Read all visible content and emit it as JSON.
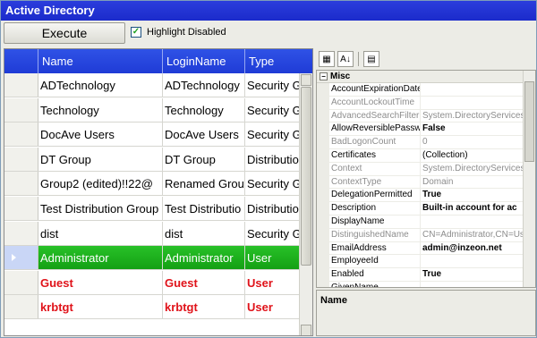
{
  "window": {
    "title": "Active Directory"
  },
  "toolbar": {
    "execute_label": "Execute",
    "highlight_label": "Highlight Disabled",
    "highlight_checked": true
  },
  "grid": {
    "columns": [
      "Name",
      "LoginName",
      "Type"
    ],
    "rows": [
      {
        "name": "ADTechnology",
        "login": "ADTechnology",
        "type": "Security G",
        "state": "normal"
      },
      {
        "name": "Technology",
        "login": "Technology",
        "type": "Security G",
        "state": "normal"
      },
      {
        "name": "DocAve Users",
        "login": "DocAve Users",
        "type": "Security G",
        "state": "normal"
      },
      {
        "name": "DT Group",
        "login": "DT Group",
        "type": "Distributio",
        "state": "normal"
      },
      {
        "name": "Group2 (edited)!!22@",
        "login": "Renamed Grou",
        "type": "Security G",
        "state": "normal"
      },
      {
        "name": "Test Distribution Group",
        "login": "Test Distributio",
        "type": "Distributio",
        "state": "normal"
      },
      {
        "name": "dist",
        "login": "dist",
        "type": "Security G",
        "state": "normal"
      },
      {
        "name": "Administrator",
        "login": "Administrator",
        "type": "User",
        "state": "selected"
      },
      {
        "name": "Guest",
        "login": "Guest",
        "type": "User",
        "state": "disabled"
      },
      {
        "name": "krbtgt",
        "login": "krbtgt",
        "type": "User",
        "state": "disabled"
      }
    ]
  },
  "properties": {
    "category": "Misc",
    "rows": [
      {
        "name": "AccountExpirationDate",
        "value": "",
        "readonly": false,
        "bold": false
      },
      {
        "name": "AccountLockoutTime",
        "value": "",
        "readonly": true,
        "bold": false
      },
      {
        "name": "AdvancedSearchFilter",
        "value": "System.DirectoryServices.",
        "readonly": true,
        "bold": false
      },
      {
        "name": "AllowReversiblePassw",
        "value": "False",
        "readonly": false,
        "bold": true
      },
      {
        "name": "BadLogonCount",
        "value": "0",
        "readonly": true,
        "bold": false
      },
      {
        "name": "Certificates",
        "value": "(Collection)",
        "readonly": false,
        "bold": false
      },
      {
        "name": "Context",
        "value": "System.DirectoryServices.",
        "readonly": true,
        "bold": false
      },
      {
        "name": "ContextType",
        "value": "Domain",
        "readonly": true,
        "bold": false
      },
      {
        "name": "DelegationPermitted",
        "value": "True",
        "readonly": false,
        "bold": true
      },
      {
        "name": "Description",
        "value": "Built-in account for ac",
        "readonly": false,
        "bold": true
      },
      {
        "name": "DisplayName",
        "value": "",
        "readonly": false,
        "bold": false
      },
      {
        "name": "DistinguishedName",
        "value": "CN=Administrator,CN=Use",
        "readonly": true,
        "bold": false
      },
      {
        "name": "EmailAddress",
        "value": "admin@inzeon.net",
        "readonly": false,
        "bold": true
      },
      {
        "name": "EmployeeId",
        "value": "",
        "readonly": false,
        "bold": false
      },
      {
        "name": "Enabled",
        "value": "True",
        "readonly": false,
        "bold": true
      },
      {
        "name": "GivenName",
        "value": "",
        "readonly": false,
        "bold": false
      }
    ],
    "description_title": "Name"
  }
}
